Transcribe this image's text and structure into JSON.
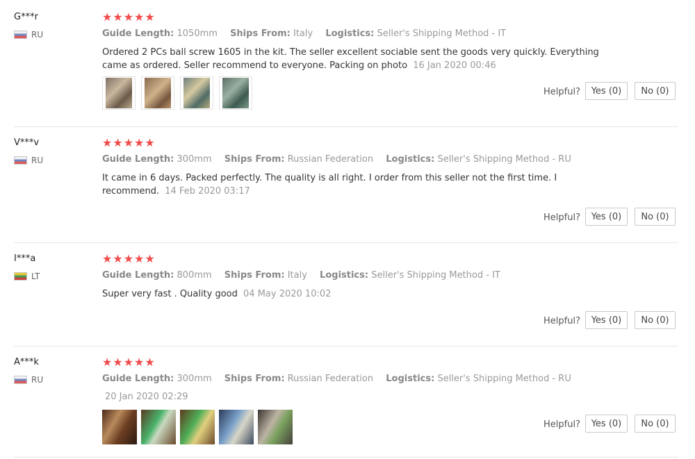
{
  "colors": {
    "star": "#f04a4a",
    "muted": "#999999",
    "text": "#333333",
    "divider": "#e6e6e6"
  },
  "labels": {
    "guide_length": "Guide Length:",
    "ships_from": "Ships From:",
    "logistics": "Logistics:",
    "helpful": "Helpful?"
  },
  "reviews": [
    {
      "user": "G***r",
      "country": "RU",
      "flag_icon": "russia-flag-icon",
      "stars": "★★★★★",
      "rating": 5,
      "guide_length": "1050mm",
      "ships_from": "Italy",
      "logistics": "Seller's Shipping Method - IT",
      "text": "Ordered 2 PCs ball screw 1605 in the kit. The seller excellent sociable sent the goods very quickly. Everything came as ordered. Seller recommend to everyone. Packing on photo",
      "date": "16 Jan 2020 00:46",
      "photos": 4,
      "yes": "Yes (0)",
      "no": "No (0)"
    },
    {
      "user": "V***v",
      "country": "RU",
      "flag_icon": "russia-flag-icon",
      "stars": "★★★★★",
      "rating": 5,
      "guide_length": "300mm",
      "ships_from": "Russian Federation",
      "logistics": "Seller's Shipping Method - RU",
      "text": "It came in 6 days. Packed perfectly. The quality is all right. I order from this seller not the first time. I recommend.",
      "date": "14 Feb 2020 03:17",
      "photos": 0,
      "yes": "Yes (0)",
      "no": "No (0)"
    },
    {
      "user": "I***a",
      "country": "LT",
      "flag_icon": "lithuania-flag-icon",
      "stars": "★★★★★",
      "rating": 5,
      "guide_length": "800mm",
      "ships_from": "Italy",
      "logistics": "Seller's Shipping Method - IT",
      "text": "Super very fast . Quality good",
      "date": "04 May 2020 10:02",
      "photos": 0,
      "yes": "Yes (0)",
      "no": "No (0)"
    },
    {
      "user": "A***k",
      "country": "RU",
      "flag_icon": "russia-flag-icon",
      "stars": "★★★★★",
      "rating": 5,
      "guide_length": "300mm",
      "ships_from": "Russian Federation",
      "logistics": "Seller's Shipping Method - RU",
      "text": "",
      "date": "20 Jan 2020 02:29",
      "photos": 5,
      "yes": "Yes (0)",
      "no": "No (0)"
    }
  ]
}
